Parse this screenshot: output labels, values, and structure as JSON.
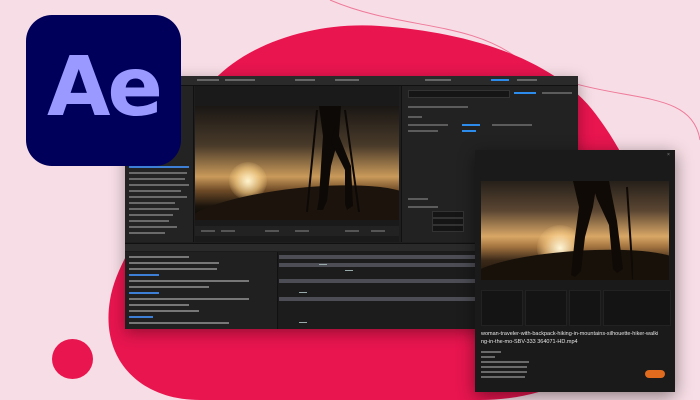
{
  "logo": {
    "text": "Ae",
    "background": "#00005b",
    "letter_color": "#9999ff"
  },
  "colors": {
    "background": "#f7dde5",
    "accent": "#e8154f",
    "ui_dark": "#1e1e1e",
    "highlight_blue": "#2d8ceb",
    "export_button": "#e06a1d"
  },
  "export_dialog": {
    "filename": "woman-traveler-with-backpack-hiking-in-mountains-silhouette-hiker-walking-in-the-mo-SBV-333 364071-HD.mp4"
  }
}
